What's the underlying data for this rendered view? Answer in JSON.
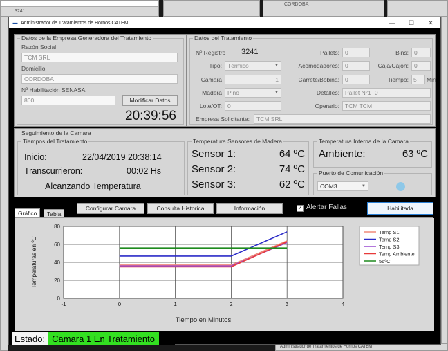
{
  "window": {
    "title": "Administrador de Tratamientos de Hornos CATEM"
  },
  "background": {
    "registro_value": "3241",
    "empresa_value": "CORDOBA",
    "taskbar_title": "Administrador de Tratamientos de Hornos CATEM"
  },
  "empresa": {
    "group_title": "Datos de la Empresa Generadora del Tratamiento",
    "razon_social_label": "Razón Social",
    "razon_social_value": "TCM SRL",
    "domicilio_label": "Domicilio",
    "domicilio_value": "CORDOBA",
    "habilitacion_label": "Nº Habilitación SENASA",
    "habilitacion_value": "800",
    "modificar_label": "Modificar Datos",
    "clock": "20:39:56"
  },
  "tratamiento": {
    "group_title": "Datos del Tratamiento",
    "registro_label": "Nº Registro",
    "registro_value": "3241",
    "tipo_label": "Tipo:",
    "tipo_value": "Térmico",
    "camara_label": "Camara",
    "camara_value": "1",
    "madera_label": "Madera",
    "madera_value": "Pino",
    "lote_label": "Lote/OT:",
    "lote_value": "0",
    "pallets_label": "Pallets:",
    "pallets_value": "0",
    "acomodadores_label": "Acomodadores:",
    "acomodadores_value": "0",
    "carrete_label": "Carrete/Bobina:",
    "carrete_value": "0",
    "detalles_label": "Detalles:",
    "detalles_value": "Pallet N°1+0",
    "operario_label": "Operario:",
    "operario_value": "TCM TCM",
    "bins_label": "Bins:",
    "bins_value": "0",
    "caja_label": "Caja/Cajon:",
    "caja_value": "0",
    "tiempo_label": "Tiempo:",
    "tiempo_value": "5",
    "tiempo_unit": "Min",
    "empresa_solicitante_label": "Empresa Solicitante:",
    "empresa_solicitante_value": "TCM SRL"
  },
  "seguimiento": {
    "group_title": "Seguimiento de la Camara",
    "tiempos_title": "Tiempos del Tratamiento",
    "inicio_label": "Inicio:",
    "inicio_value": "22/04/2019 20:38:14",
    "transcurrieron_label": "Transcurrieron:",
    "transcurrieron_value": "00:02 Hs",
    "estado_texto": "Alcanzando Temperatura",
    "sensores_title": "Temperatura Sensores de Madera",
    "sensores": [
      {
        "label": "Sensor 1:",
        "value": "64 ºC"
      },
      {
        "label": "Sensor 2:",
        "value": "74 ºC"
      },
      {
        "label": "Sensor 3:",
        "value": "62 ºC"
      }
    ],
    "interna_title": "Temperatura Interna de la Camara",
    "ambiente_label": "Ambiente:",
    "ambiente_value": "63 ºC",
    "puerto_title": "Puerto de Comunicación",
    "puerto_value": "COM3",
    "status_color": "#8ec8e8"
  },
  "toolbar": {
    "tab_grafico": "Gráfico",
    "tab_tabla": "Tabla",
    "configurar_label": "Configurar Camara",
    "consulta_label": "Consulta Historica",
    "informacion_label": "Información",
    "alertar_label": "Alertar Fallas",
    "alertar_checked": true,
    "habilitada_label": "Habilitada"
  },
  "chart_data": {
    "type": "line",
    "xlabel": "Tiempo en Minutos",
    "ylabel": "Temperaturas en ºC",
    "xlim": [
      -1,
      4
    ],
    "ylim": [
      0,
      80
    ],
    "xticks": [
      -1,
      0,
      1,
      2,
      3,
      4
    ],
    "yticks": [
      0,
      20,
      40,
      60,
      80
    ],
    "grid": true,
    "legend_position": "top-right",
    "series": [
      {
        "name": "Temp S1",
        "color": "#f08a7a",
        "x": [
          0,
          1,
          2,
          3
        ],
        "y": [
          37,
          37,
          37,
          64
        ]
      },
      {
        "name": "Temp S2",
        "color": "#2b2bc8",
        "x": [
          0,
          1,
          2,
          3
        ],
        "y": [
          47,
          47,
          47,
          74
        ]
      },
      {
        "name": "Temp S3",
        "color": "#9a4ad0",
        "x": [
          0,
          1,
          2,
          3
        ],
        "y": [
          36,
          36,
          36,
          62
        ]
      },
      {
        "name": "Temp Ambiente",
        "color": "#e83a3a",
        "x": [
          0,
          1,
          2,
          3
        ],
        "y": [
          35,
          35,
          35,
          63
        ]
      },
      {
        "name": "56ºC",
        "color": "#1e8a1e",
        "x": [
          0,
          1,
          2,
          3
        ],
        "y": [
          56,
          56,
          56,
          56
        ]
      }
    ]
  },
  "status": {
    "label": "Estado:",
    "value": "Camara 1 En Tratamiento"
  }
}
